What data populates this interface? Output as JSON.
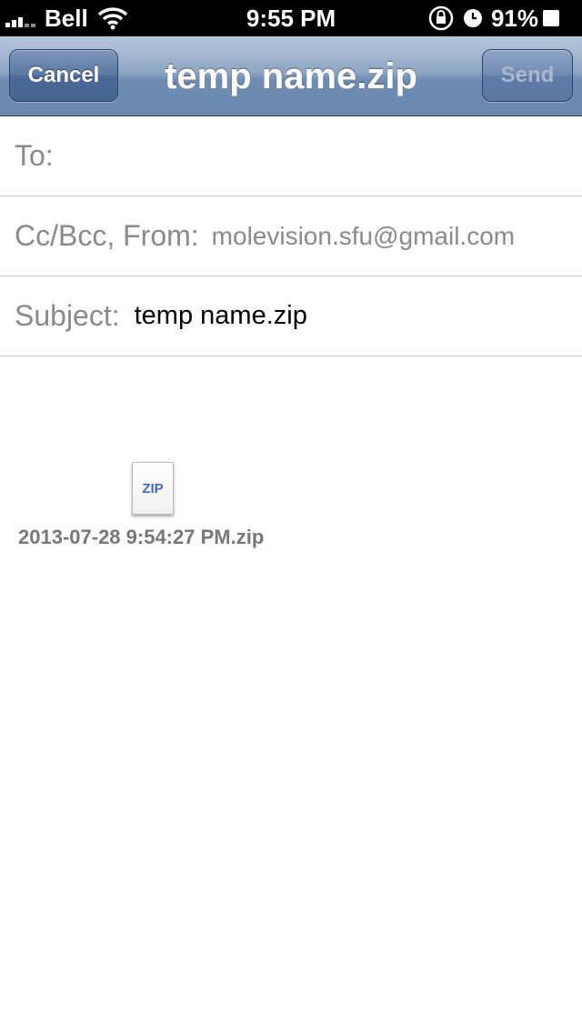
{
  "status_bar": {
    "carrier": "Bell",
    "time": "9:55 PM",
    "battery": "91%"
  },
  "nav": {
    "title": "temp name.zip",
    "cancel_label": "Cancel",
    "send_label": "Send"
  },
  "fields": {
    "to_label": "To:",
    "cc_label": "Cc/Bcc, From:",
    "from_value": "molevision.sfu@gmail.com",
    "subject_label": "Subject:",
    "subject_value": "temp name.zip"
  },
  "attachment": {
    "icon_text": "ZIP",
    "file_name": "2013-07-28 9:54:27 PM.zip"
  },
  "colors": {
    "nav_bar": "#7b96bb",
    "label_gray": "#8a8a8a",
    "zip_blue": "#4466cc"
  },
  "icons": [
    "signal-icon",
    "wifi-icon",
    "rotation-lock-icon",
    "alarm-clock-icon",
    "battery-icon"
  ]
}
